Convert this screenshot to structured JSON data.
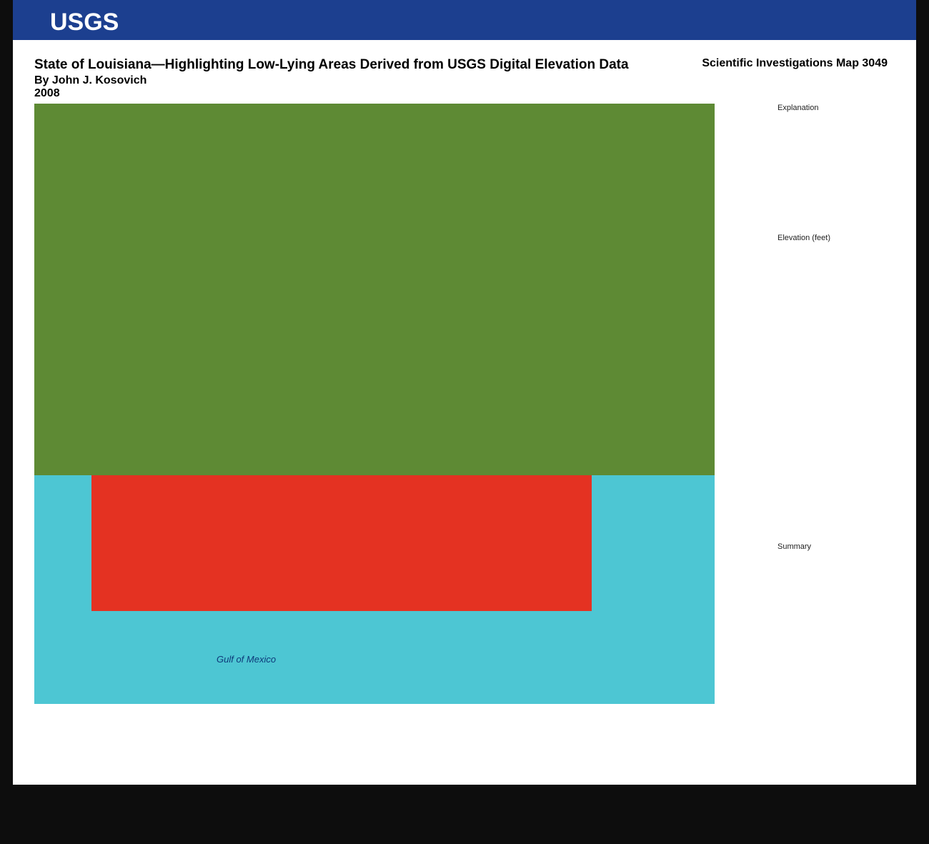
{
  "logo": "USGS",
  "title": "State of Louisiana—Highlighting Low-Lying Areas Derived from USGS Digital Elevation Data",
  "author": "By John J. Kosovich",
  "year": "2008",
  "series": "Scientific Investigations Map 3049",
  "gulf": "Gulf of Mexico",
  "explanation": "Explanation",
  "elevation": "Elevation (feet)",
  "summary": "Summary"
}
